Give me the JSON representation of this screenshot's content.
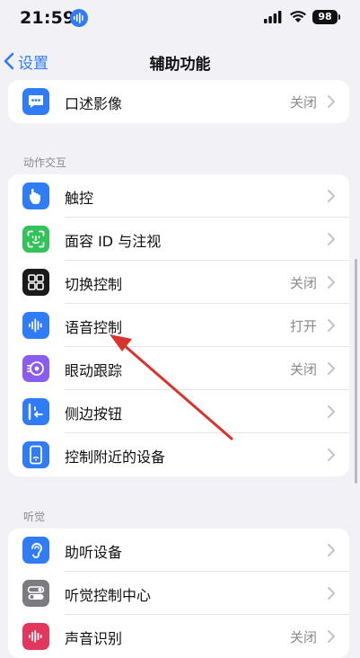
{
  "status_bar": {
    "time": "21:59",
    "battery": "98"
  },
  "nav": {
    "back_label": "设置",
    "title": "辅助功能"
  },
  "sections": {
    "top": {
      "items": [
        {
          "label": "口述影像",
          "value": "关闭"
        }
      ]
    },
    "interaction": {
      "header": "动作交互",
      "items": [
        {
          "label": "触控",
          "value": ""
        },
        {
          "label": "面容 ID 与注视",
          "value": ""
        },
        {
          "label": "切换控制",
          "value": "关闭"
        },
        {
          "label": "语音控制",
          "value": "打开"
        },
        {
          "label": "眼动跟踪",
          "value": "关闭"
        },
        {
          "label": "侧边按钮",
          "value": ""
        },
        {
          "label": "控制附近的设备",
          "value": ""
        }
      ]
    },
    "hearing": {
      "header": "听觉",
      "items": [
        {
          "label": "助听设备",
          "value": ""
        },
        {
          "label": "听觉控制中心",
          "value": ""
        },
        {
          "label": "声音识别",
          "value": "关闭"
        }
      ]
    }
  },
  "colors": {
    "accent": "#2f7cf6",
    "annotation_arrow": "#d8332d",
    "background": "#f1f1f6"
  },
  "icons": {
    "top": [
      "audio-description-icon"
    ],
    "interaction": [
      "touch-icon",
      "face-id-icon",
      "switch-control-icon",
      "voice-control-icon",
      "eye-tracking-icon",
      "side-button-icon",
      "control-nearby-devices-icon"
    ],
    "hearing": [
      "hearing-devices-icon",
      "hearing-control-center-icon",
      "sound-recognition-icon"
    ]
  }
}
